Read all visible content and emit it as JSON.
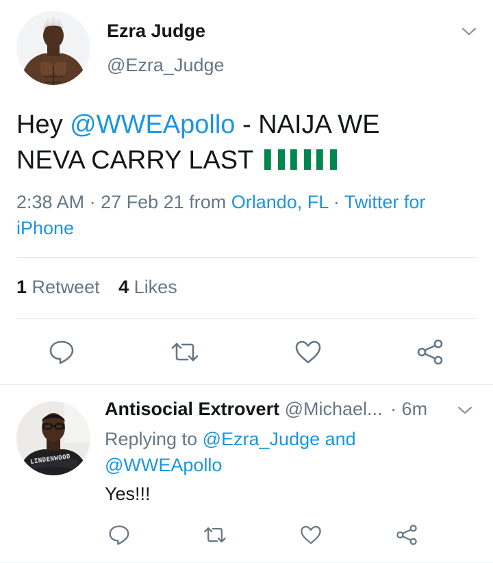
{
  "tweet": {
    "author_name": "Ezra Judge",
    "author_handle": "@Ezra_Judge",
    "text_prefix": "Hey ",
    "mention": "@WWEApollo",
    "text_line1_rest": " - NAIJA WE",
    "text_line2": "NEVA CARRY LAST",
    "flags": "🇳🇬🇳🇬🇳🇬",
    "time": "2:38 AM",
    "date": "27 Feb 21",
    "from_label": "from",
    "location": "Orlando, FL",
    "client_line1": "Twitter for",
    "client_line2": "iPhone",
    "separator": "·",
    "retweet_count": "1",
    "retweet_label": "Retweet",
    "like_count": "4",
    "like_label": "Likes",
    "icons": [
      "chevron-down-icon",
      "reply-icon",
      "retweet-icon",
      "like-icon",
      "share-icon"
    ]
  },
  "reply": {
    "author_name": "Antisocial Extrovert",
    "author_handle": "@Michael...",
    "time_ago": "· 6m",
    "replying_to": "Replying to",
    "mention1": "@Ezra_Judge",
    "and": "and",
    "mention2": "@WWEApollo",
    "text": "Yes!!!",
    "avatar_shirt_text": "LINDENWOOD"
  },
  "colors": {
    "accent": "#1b95e0",
    "secondary_text": "#657786",
    "primary_text": "#14171a",
    "divider": "#d8dde1",
    "flag_green": "#008751"
  }
}
